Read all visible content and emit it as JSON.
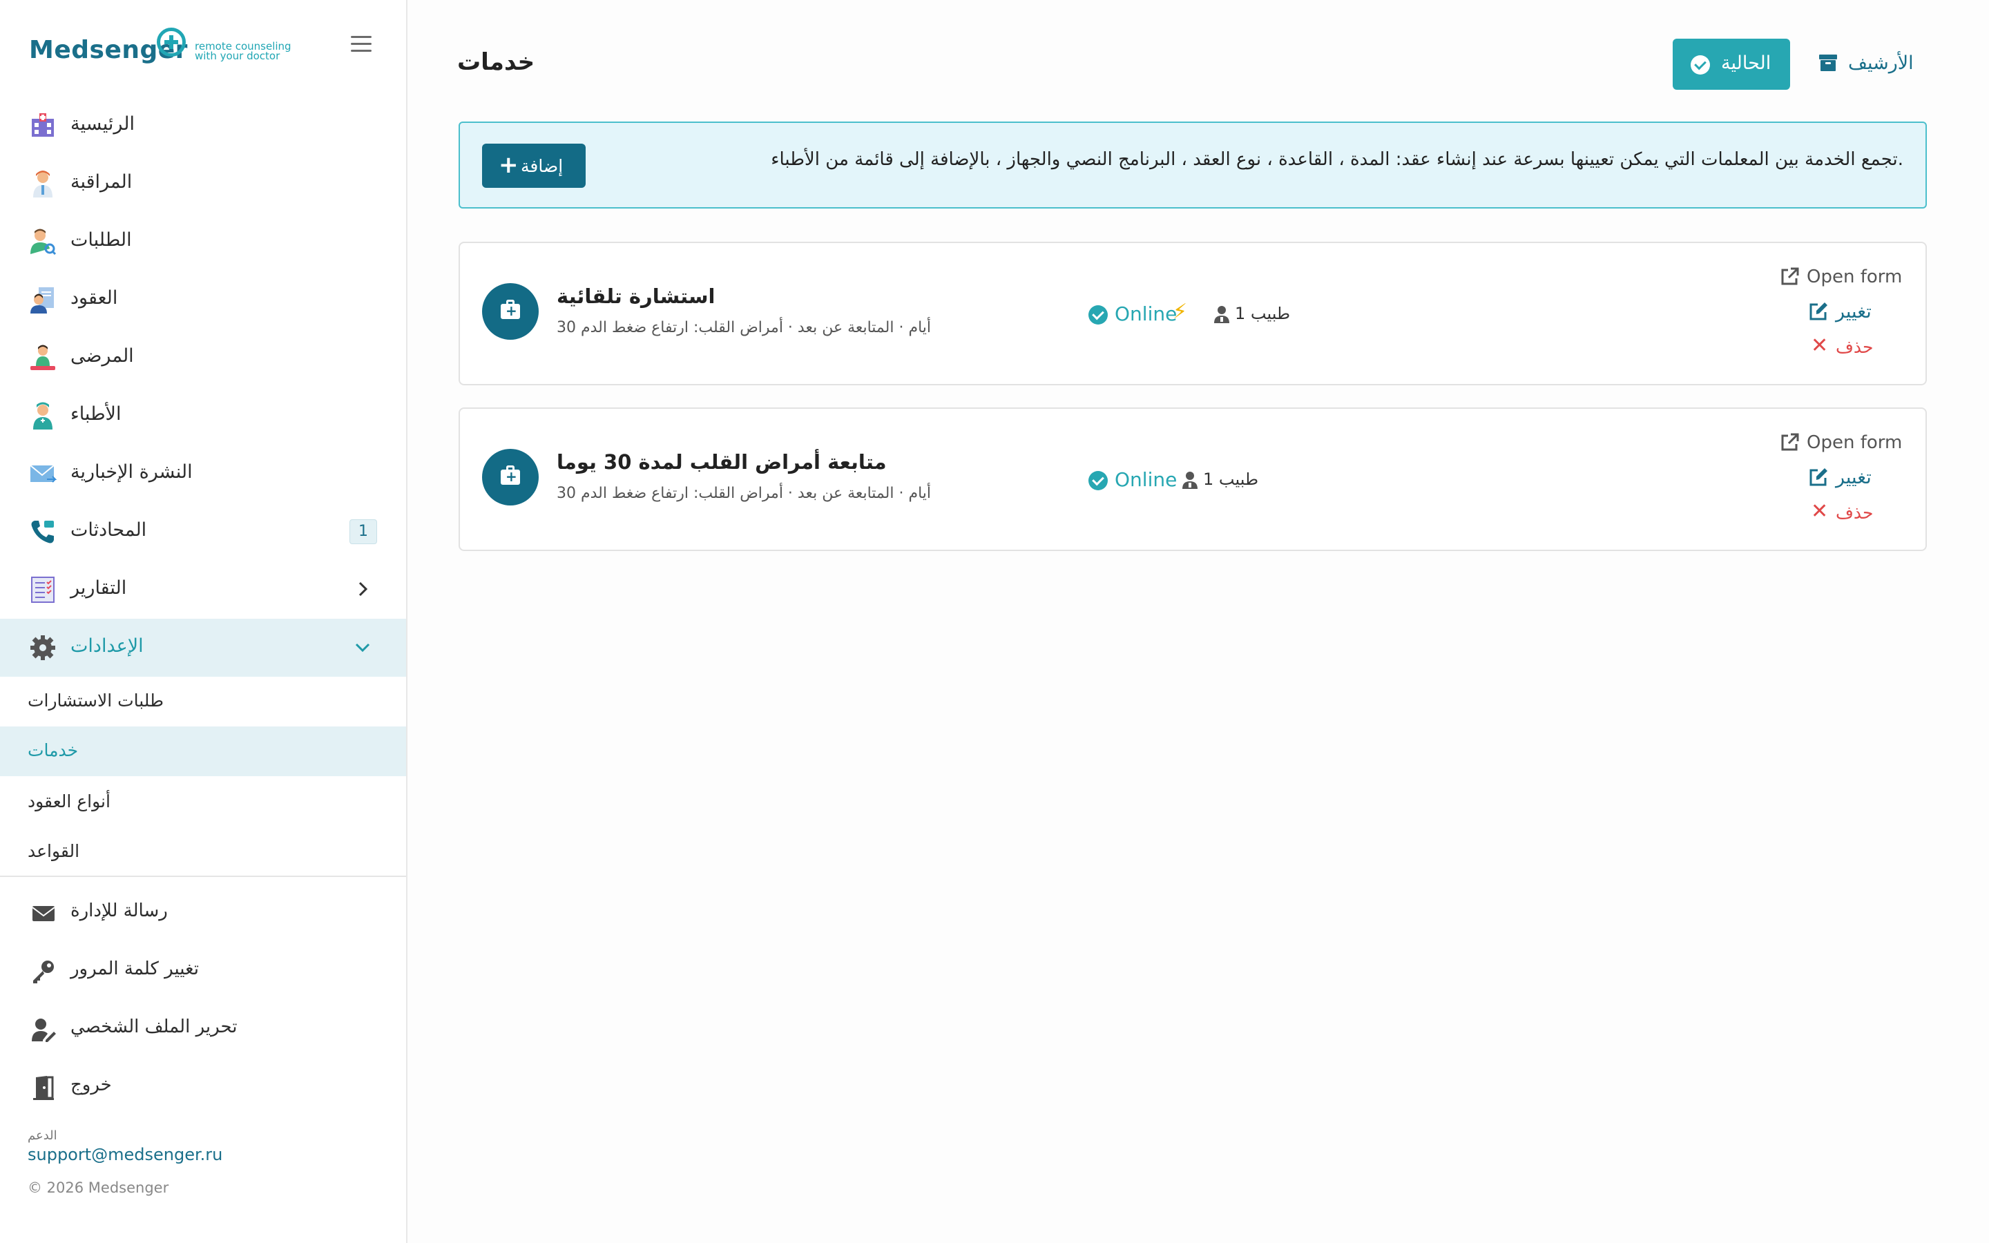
{
  "brand": {
    "name": "Medsenger",
    "tagline_line1": "remote counseling",
    "tagline_line2": "with your doctor"
  },
  "sidebar": {
    "nav": [
      {
        "label": "الرئيسية",
        "icon": "hospital-icon"
      },
      {
        "label": "المراقبة",
        "icon": "doctor-icon"
      },
      {
        "label": "الطلبات",
        "icon": "user-search-icon"
      },
      {
        "label": "العقود",
        "icon": "contract-icon"
      },
      {
        "label": "المرضى",
        "icon": "patient-icon"
      },
      {
        "label": "الأطباء",
        "icon": "nurse-icon"
      },
      {
        "label": "النشرة الإخبارية",
        "icon": "mail-send-icon"
      },
      {
        "label": "المحادثات",
        "icon": "phone-icon",
        "badge": "1"
      },
      {
        "label": "التقارير",
        "icon": "report-icon"
      },
      {
        "label": "الإعدادات",
        "icon": "gear-icon"
      }
    ],
    "settings_sub": [
      {
        "label": "طلبات الاستشارات"
      },
      {
        "label": "خدمات"
      },
      {
        "label": "أنواع العقود"
      },
      {
        "label": "القواعد"
      }
    ],
    "bottom": [
      {
        "label": "رسالة للإدارة",
        "icon": "envelope-icon"
      },
      {
        "label": "تغيير كلمة المرور",
        "icon": "key-icon"
      },
      {
        "label": "تحرير الملف الشخصي",
        "icon": "user-edit-icon"
      },
      {
        "label": "خروج",
        "icon": "door-exit-icon"
      }
    ],
    "support_label": "الدعم",
    "support_email": "support@medsenger.ru",
    "copyright": "© 2026 Medsenger"
  },
  "main": {
    "title": "خدمات",
    "btn_current": "الحالية",
    "btn_archive": "الأرشيف",
    "info_text": ".تجمع الخدمة بين المعلمات التي يمكن تعيينها بسرعة عند إنشاء عقد: المدة ، القاعدة ، نوع العقد ، البرنامج النصي والجهاز ، بالإضافة إلى قائمة من الأطباء",
    "btn_add": "إضافة",
    "services": [
      {
        "name": "استشارة تلقائية",
        "desc": "30 أيام · المتابعة عن بعد · أمراض القلب: ارتفاع ضغط الدم",
        "status": "Online",
        "lightning": true,
        "doctors": "1 طبيب",
        "open": "Open form",
        "edit": "تغيير",
        "delete": "حذف"
      },
      {
        "name": "متابعة أمراض القلب لمدة 30 يوما",
        "desc": "30 أيام · المتابعة عن بعد · أمراض القلب: ارتفاع ضغط الدم",
        "status": "Online",
        "lightning": false,
        "doctors": "1 طبيب",
        "open": "Open form",
        "edit": "تغيير",
        "delete": "حذف"
      }
    ]
  },
  "colors": {
    "accent": "#27a7b2",
    "brand_dark": "#136b86",
    "danger": "#e04848",
    "active_bg": "#e3f1f5"
  }
}
